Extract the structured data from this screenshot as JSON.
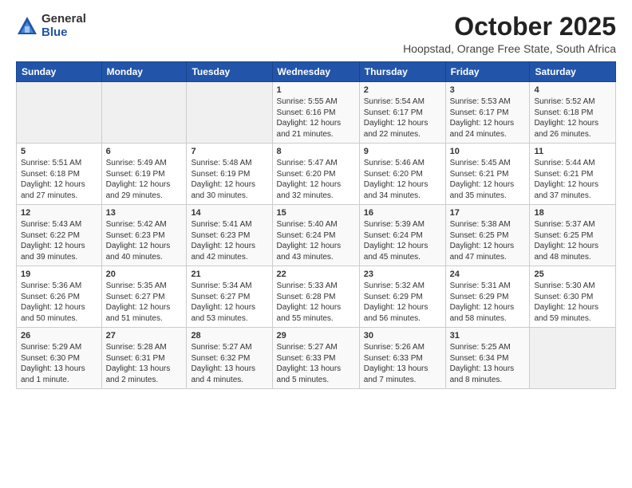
{
  "logo": {
    "general": "General",
    "blue": "Blue"
  },
  "title": "October 2025",
  "subtitle": "Hoopstad, Orange Free State, South Africa",
  "headers": [
    "Sunday",
    "Monday",
    "Tuesday",
    "Wednesday",
    "Thursday",
    "Friday",
    "Saturday"
  ],
  "weeks": [
    [
      {
        "day": "",
        "info": ""
      },
      {
        "day": "",
        "info": ""
      },
      {
        "day": "",
        "info": ""
      },
      {
        "day": "1",
        "info": "Sunrise: 5:55 AM\nSunset: 6:16 PM\nDaylight: 12 hours\nand 21 minutes."
      },
      {
        "day": "2",
        "info": "Sunrise: 5:54 AM\nSunset: 6:17 PM\nDaylight: 12 hours\nand 22 minutes."
      },
      {
        "day": "3",
        "info": "Sunrise: 5:53 AM\nSunset: 6:17 PM\nDaylight: 12 hours\nand 24 minutes."
      },
      {
        "day": "4",
        "info": "Sunrise: 5:52 AM\nSunset: 6:18 PM\nDaylight: 12 hours\nand 26 minutes."
      }
    ],
    [
      {
        "day": "5",
        "info": "Sunrise: 5:51 AM\nSunset: 6:18 PM\nDaylight: 12 hours\nand 27 minutes."
      },
      {
        "day": "6",
        "info": "Sunrise: 5:49 AM\nSunset: 6:19 PM\nDaylight: 12 hours\nand 29 minutes."
      },
      {
        "day": "7",
        "info": "Sunrise: 5:48 AM\nSunset: 6:19 PM\nDaylight: 12 hours\nand 30 minutes."
      },
      {
        "day": "8",
        "info": "Sunrise: 5:47 AM\nSunset: 6:20 PM\nDaylight: 12 hours\nand 32 minutes."
      },
      {
        "day": "9",
        "info": "Sunrise: 5:46 AM\nSunset: 6:20 PM\nDaylight: 12 hours\nand 34 minutes."
      },
      {
        "day": "10",
        "info": "Sunrise: 5:45 AM\nSunset: 6:21 PM\nDaylight: 12 hours\nand 35 minutes."
      },
      {
        "day": "11",
        "info": "Sunrise: 5:44 AM\nSunset: 6:21 PM\nDaylight: 12 hours\nand 37 minutes."
      }
    ],
    [
      {
        "day": "12",
        "info": "Sunrise: 5:43 AM\nSunset: 6:22 PM\nDaylight: 12 hours\nand 39 minutes."
      },
      {
        "day": "13",
        "info": "Sunrise: 5:42 AM\nSunset: 6:23 PM\nDaylight: 12 hours\nand 40 minutes."
      },
      {
        "day": "14",
        "info": "Sunrise: 5:41 AM\nSunset: 6:23 PM\nDaylight: 12 hours\nand 42 minutes."
      },
      {
        "day": "15",
        "info": "Sunrise: 5:40 AM\nSunset: 6:24 PM\nDaylight: 12 hours\nand 43 minutes."
      },
      {
        "day": "16",
        "info": "Sunrise: 5:39 AM\nSunset: 6:24 PM\nDaylight: 12 hours\nand 45 minutes."
      },
      {
        "day": "17",
        "info": "Sunrise: 5:38 AM\nSunset: 6:25 PM\nDaylight: 12 hours\nand 47 minutes."
      },
      {
        "day": "18",
        "info": "Sunrise: 5:37 AM\nSunset: 6:25 PM\nDaylight: 12 hours\nand 48 minutes."
      }
    ],
    [
      {
        "day": "19",
        "info": "Sunrise: 5:36 AM\nSunset: 6:26 PM\nDaylight: 12 hours\nand 50 minutes."
      },
      {
        "day": "20",
        "info": "Sunrise: 5:35 AM\nSunset: 6:27 PM\nDaylight: 12 hours\nand 51 minutes."
      },
      {
        "day": "21",
        "info": "Sunrise: 5:34 AM\nSunset: 6:27 PM\nDaylight: 12 hours\nand 53 minutes."
      },
      {
        "day": "22",
        "info": "Sunrise: 5:33 AM\nSunset: 6:28 PM\nDaylight: 12 hours\nand 55 minutes."
      },
      {
        "day": "23",
        "info": "Sunrise: 5:32 AM\nSunset: 6:29 PM\nDaylight: 12 hours\nand 56 minutes."
      },
      {
        "day": "24",
        "info": "Sunrise: 5:31 AM\nSunset: 6:29 PM\nDaylight: 12 hours\nand 58 minutes."
      },
      {
        "day": "25",
        "info": "Sunrise: 5:30 AM\nSunset: 6:30 PM\nDaylight: 12 hours\nand 59 minutes."
      }
    ],
    [
      {
        "day": "26",
        "info": "Sunrise: 5:29 AM\nSunset: 6:30 PM\nDaylight: 13 hours\nand 1 minute."
      },
      {
        "day": "27",
        "info": "Sunrise: 5:28 AM\nSunset: 6:31 PM\nDaylight: 13 hours\nand 2 minutes."
      },
      {
        "day": "28",
        "info": "Sunrise: 5:27 AM\nSunset: 6:32 PM\nDaylight: 13 hours\nand 4 minutes."
      },
      {
        "day": "29",
        "info": "Sunrise: 5:27 AM\nSunset: 6:33 PM\nDaylight: 13 hours\nand 5 minutes."
      },
      {
        "day": "30",
        "info": "Sunrise: 5:26 AM\nSunset: 6:33 PM\nDaylight: 13 hours\nand 7 minutes."
      },
      {
        "day": "31",
        "info": "Sunrise: 5:25 AM\nSunset: 6:34 PM\nDaylight: 13 hours\nand 8 minutes."
      },
      {
        "day": "",
        "info": ""
      }
    ]
  ]
}
